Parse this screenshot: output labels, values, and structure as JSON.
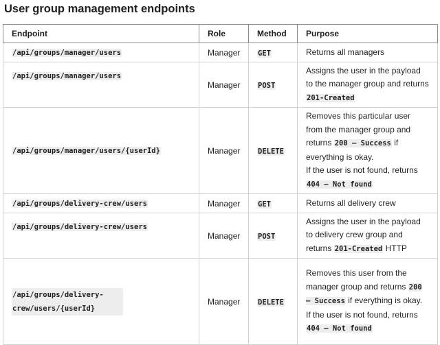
{
  "title": "User group management endpoints",
  "headers": {
    "endpoint": "Endpoint",
    "role": "Role",
    "method": "Method",
    "purpose": "Purpose"
  },
  "rows": [
    {
      "endpoint": "/api/groups/manager/users",
      "role": "Manager",
      "method": "GET",
      "purpose": [
        [
          "Returns all managers"
        ]
      ]
    },
    {
      "endpoint": "/api/groups/manager/users",
      "role": "Manager",
      "method": "POST",
      "purpose": [
        [
          "Assigns the user in the payload to the manager group and returns ",
          {
            "code": "201-Created"
          }
        ]
      ]
    },
    {
      "endpoint": "/api/groups/manager/users/{userId}",
      "role": "Manager",
      "method": "DELETE",
      "purpose": [
        [
          "Removes this particular user from the manager group and returns ",
          {
            "code": "200 – Success"
          },
          " if everything is okay."
        ],
        [
          "If the user is not found, returns ",
          {
            "code": "404 – Not found"
          }
        ]
      ]
    },
    {
      "endpoint": "/api/groups/delivery-crew/users",
      "role": "Manager",
      "method": "GET",
      "purpose": [
        [
          "Returns all delivery crew"
        ]
      ]
    },
    {
      "endpoint": "/api/groups/delivery-crew/users",
      "role": "Manager",
      "method": "POST",
      "purpose": [
        [
          "Assigns the user in the payload to delivery crew group and returns ",
          {
            "code": "201-Created"
          },
          " HTTP"
        ]
      ]
    },
    {
      "endpoint": "/api/groups/delivery-crew/users/{userId}",
      "role": "Manager",
      "method": "DELETE",
      "purpose": [
        [
          "Removes this user from the manager group and returns ",
          {
            "code": "200 – Success"
          },
          " if everything is okay."
        ],
        [
          "If the user is not found, returns ",
          {
            "code": "404 – Not found"
          }
        ]
      ]
    }
  ]
}
